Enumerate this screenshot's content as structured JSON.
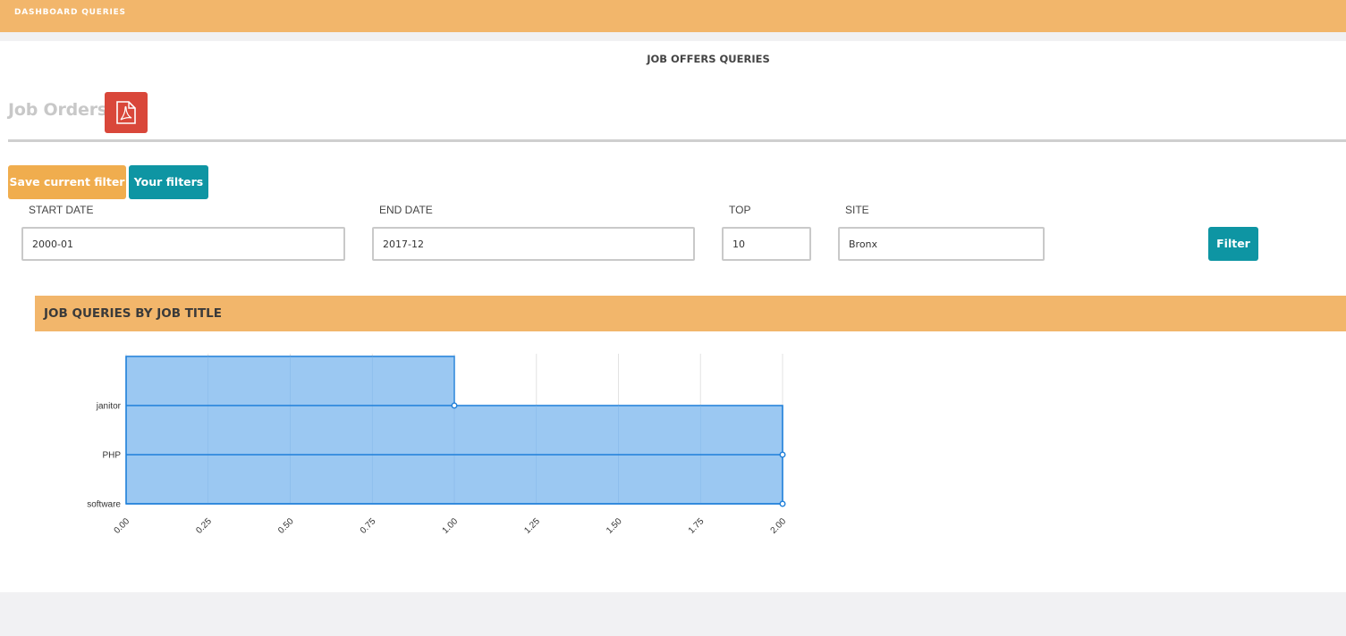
{
  "topbar": {
    "brand": "DASHBOARD QUERIES"
  },
  "page": {
    "title": "JOB OFFERS QUERIES",
    "section_title": "Job Orders"
  },
  "buttons": {
    "save_filter": "Save current filter",
    "your_filters": "Your filters",
    "filter": "Filter"
  },
  "filters": {
    "start_date": {
      "label": "START DATE",
      "value": "2000-01"
    },
    "end_date": {
      "label": "END DATE",
      "value": "2017-12"
    },
    "top": {
      "label": "TOP",
      "value": "10"
    },
    "site": {
      "label": "SITE",
      "value": "Bronx"
    }
  },
  "chart_header": "JOB QUERIES BY JOB TITLE",
  "colors": {
    "header": "#f2b66b",
    "primary": "#0e95a3",
    "warning": "#f0ad4e",
    "pdf": "#d9473a",
    "series_fill": "#9bc8f2",
    "series_line": "#1e7fd9"
  },
  "chart_data": {
    "type": "area",
    "orientation": "horizontal",
    "categories": [
      "janitor",
      "PHP",
      "software"
    ],
    "values": [
      1,
      2,
      2
    ],
    "first_row_value": 1,
    "xlim": [
      0,
      2
    ],
    "xticks": [
      "0.00",
      "0.25",
      "0.50",
      "0.75",
      "1.00",
      "1.25",
      "1.50",
      "1.75",
      "2.00"
    ],
    "title": "",
    "xlabel": "",
    "ylabel": "",
    "grid": true,
    "legend": "none"
  }
}
